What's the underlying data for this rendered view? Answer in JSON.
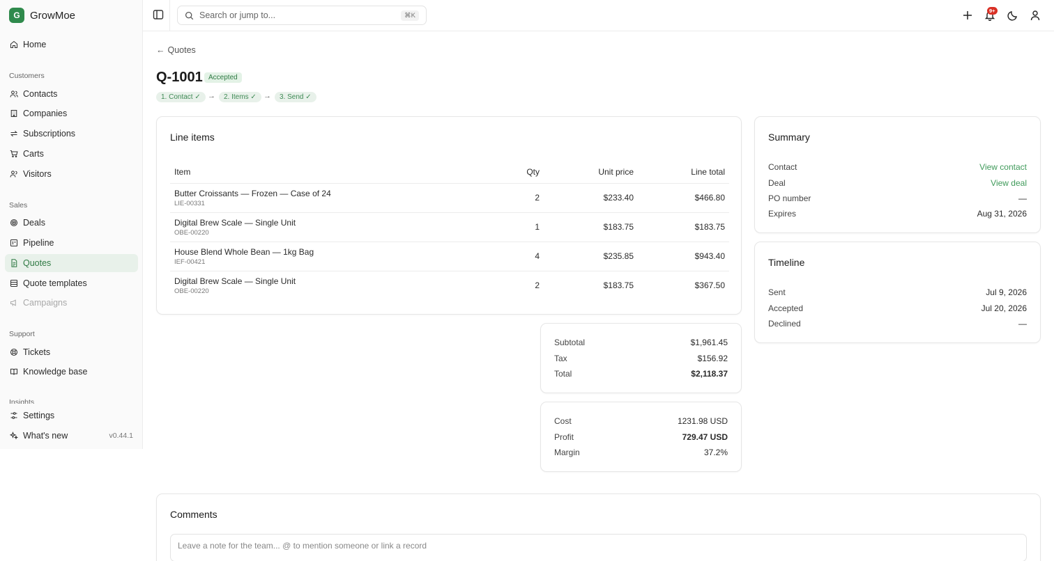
{
  "app": {
    "name": "GrowMoe",
    "logo_letter": "G",
    "accent": "#2f8a4c"
  },
  "sidebar": {
    "home": "Home",
    "customers_label": "Customers",
    "customers": [
      "Contacts",
      "Companies",
      "Subscriptions",
      "Carts",
      "Visitors"
    ],
    "sales_label": "Sales",
    "sales": [
      "Deals",
      "Pipeline",
      "Quotes",
      "Quote templates",
      "Campaigns"
    ],
    "support_label": "Support",
    "support": [
      "Tickets",
      "Knowledge base"
    ],
    "insights_label": "Insights",
    "settings": "Settings",
    "whats_new": "What's new",
    "version": "v0.44.1"
  },
  "topbar": {
    "search_placeholder": "Search or jump to...",
    "search_shortcut": "⌘K",
    "notification_count": "9+"
  },
  "quote": {
    "back_label": "Quotes",
    "id": "Q-1001",
    "status": "Accepted",
    "steps": [
      "1. Contact ✓",
      "2. Items ✓",
      "3. Send ✓"
    ]
  },
  "line_items": {
    "title": "Line items",
    "headers": {
      "item": "Item",
      "qty": "Qty",
      "unit_price": "Unit price",
      "line_total": "Line total"
    },
    "rows": [
      {
        "name": "Butter Croissants — Frozen — Case of 24",
        "sku": "LIE-00331",
        "qty": "2",
        "unit_price": "$233.40",
        "line_total": "$466.80"
      },
      {
        "name": "Digital Brew Scale — Single Unit",
        "sku": "OBE-00220",
        "qty": "1",
        "unit_price": "$183.75",
        "line_total": "$183.75"
      },
      {
        "name": "House Blend Whole Bean — 1kg Bag",
        "sku": "IEF-00421",
        "qty": "4",
        "unit_price": "$235.85",
        "line_total": "$943.40"
      },
      {
        "name": "Digital Brew Scale — Single Unit",
        "sku": "OBE-00220",
        "qty": "2",
        "unit_price": "$183.75",
        "line_total": "$367.50"
      }
    ]
  },
  "totals": {
    "subtotal_label": "Subtotal",
    "subtotal": "$1,961.45",
    "tax_label": "Tax",
    "tax": "$156.92",
    "total_label": "Total",
    "total": "$2,118.37"
  },
  "profit": {
    "cost_label": "Cost",
    "cost": "1231.98 USD",
    "profit_label": "Profit",
    "profit": "729.47 USD",
    "margin_label": "Margin",
    "margin": "37.2%"
  },
  "summary": {
    "title": "Summary",
    "contact_label": "Contact",
    "contact_link": "View contact",
    "deal_label": "Deal",
    "deal_link": "View deal",
    "po_label": "PO number",
    "po": "—",
    "expires_label": "Expires",
    "expires": "Aug 31, 2026"
  },
  "timeline": {
    "title": "Timeline",
    "sent_label": "Sent",
    "sent": "Jul 9, 2026",
    "accepted_label": "Accepted",
    "accepted": "Jul 20, 2026",
    "declined_label": "Declined",
    "declined": "—"
  },
  "comments": {
    "title": "Comments",
    "placeholder": "Leave a note for the team... @ to mention someone or link a record"
  }
}
